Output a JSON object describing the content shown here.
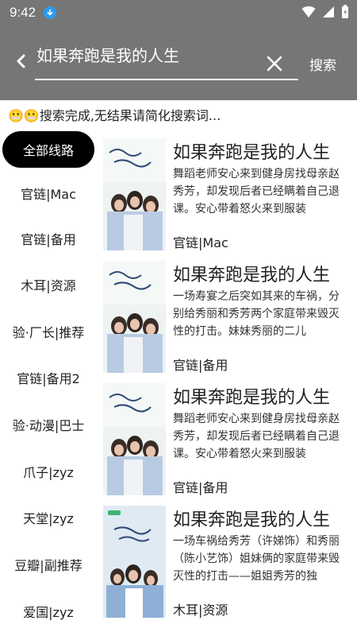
{
  "status_bar": {
    "time": "9:42"
  },
  "header": {
    "query": "如果奔跑是我的人生",
    "search_label": "搜索"
  },
  "status_message": "😬😬搜索完成,无结果请简化搜索词...",
  "sidebar": {
    "items": [
      {
        "label": "全部线路",
        "active": true
      },
      {
        "label": "官链|Mac"
      },
      {
        "label": "官链|备用"
      },
      {
        "label": "木耳|资源"
      },
      {
        "label": "验·厂长|推荐"
      },
      {
        "label": "官链|备用2"
      },
      {
        "label": "验·动漫|巴士"
      },
      {
        "label": "爪子|zyz"
      },
      {
        "label": "天堂|zyz"
      },
      {
        "label": "豆瓣|副推荐"
      },
      {
        "label": "爱国|zyz"
      }
    ]
  },
  "results": [
    {
      "title": "如果奔跑是我的人生",
      "desc": "舞蹈老师安心来到健身房找母亲赵秀芳，却发现后者已经瞒着自己退课。安心带着怒火来到服装",
      "source": "官链|Mac"
    },
    {
      "title": "如果奔跑是我的人生",
      "desc": "一场寿宴之后突如其来的车祸，分别给秀丽和秀芳两个家庭带来毁灭性的打击。妹妹秀丽的二儿",
      "source": "官链|备用"
    },
    {
      "title": "如果奔跑是我的人生",
      "desc": "舞蹈老师安心来到健身房找母亲赵秀芳，却发现后者已经瞒着自己退课。安心带着怒火来到服装",
      "source": "官链|备用"
    },
    {
      "title": "如果奔跑是我的人生",
      "desc": "一场车祸给秀芳（许娣饰）和秀丽（陈小艺饰）姐妹俩的家庭带来毁灭性的打击——姐姐秀芳的独",
      "source": "木耳|资源"
    }
  ],
  "colors": {
    "header_bg": "#767676",
    "active_tab_bg": "#000000"
  }
}
